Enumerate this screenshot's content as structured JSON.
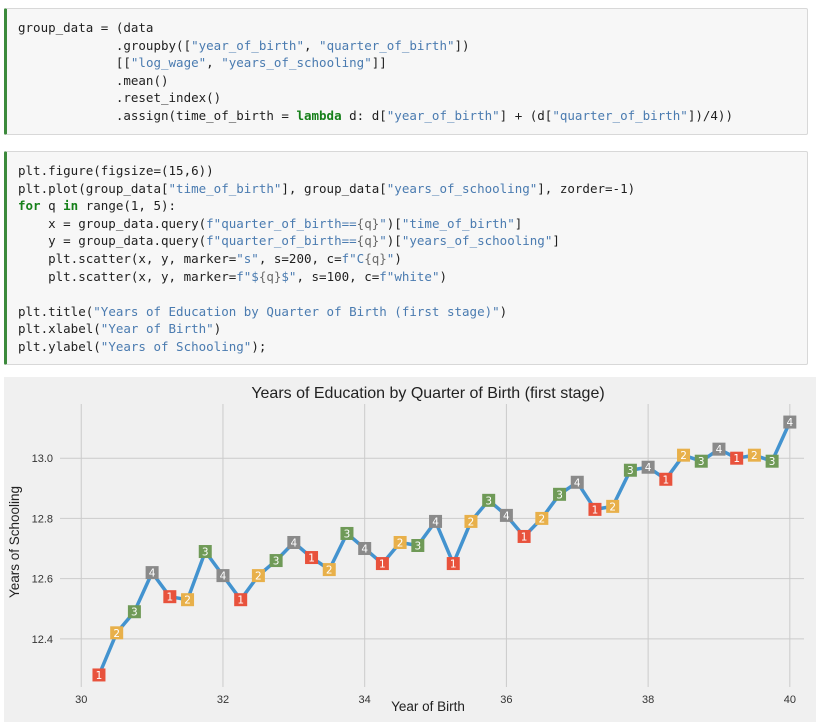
{
  "cells": [
    {
      "lines": [
        [
          [
            "t",
            "group_data = (data"
          ]
        ],
        [
          [
            "t",
            "             .groupby(["
          ],
          [
            "s",
            "\"year_of_birth\""
          ],
          [
            "t",
            ", "
          ],
          [
            "s",
            "\"quarter_of_birth\""
          ],
          [
            "t",
            "])"
          ]
        ],
        [
          [
            "t",
            "             [["
          ],
          [
            "s",
            "\"log_wage\""
          ],
          [
            "t",
            ", "
          ],
          [
            "s",
            "\"years_of_schooling\""
          ],
          [
            "t",
            "]]"
          ]
        ],
        [
          [
            "t",
            "             .mean()"
          ]
        ],
        [
          [
            "t",
            "             .reset_index()"
          ]
        ],
        [
          [
            "t",
            "             .assign(time_of_birth = "
          ],
          [
            "k",
            "lambda"
          ],
          [
            "t",
            " d: d["
          ],
          [
            "s",
            "\"year_of_birth\""
          ],
          [
            "t",
            "] + (d["
          ],
          [
            "s",
            "\"quarter_of_birth\""
          ],
          [
            "t",
            "])/4))"
          ]
        ]
      ]
    },
    {
      "lines": [
        [
          [
            "t",
            "plt.figure(figsize=(15,6))"
          ]
        ],
        [
          [
            "t",
            "plt.plot(group_data["
          ],
          [
            "s",
            "\"time_of_birth\""
          ],
          [
            "t",
            "], group_data["
          ],
          [
            "s",
            "\"years_of_schooling\""
          ],
          [
            "t",
            "], zorder=-1)"
          ]
        ],
        [
          [
            "k",
            "for"
          ],
          [
            "t",
            " q "
          ],
          [
            "k",
            "in"
          ],
          [
            "t",
            " range(1, 5):"
          ]
        ],
        [
          [
            "t",
            "    x = group_data.query("
          ],
          [
            "s",
            "f\"quarter_of_birth=="
          ],
          [
            "fi",
            "{q}"
          ],
          [
            "s",
            "\""
          ],
          [
            "t",
            ")["
          ],
          [
            "s",
            "\"time_of_birth\""
          ],
          [
            "t",
            "]"
          ]
        ],
        [
          [
            "t",
            "    y = group_data.query("
          ],
          [
            "s",
            "f\"quarter_of_birth=="
          ],
          [
            "fi",
            "{q}"
          ],
          [
            "s",
            "\""
          ],
          [
            "t",
            ")["
          ],
          [
            "s",
            "\"years_of_schooling\""
          ],
          [
            "t",
            "]"
          ]
        ],
        [
          [
            "t",
            "    plt.scatter(x, y, marker="
          ],
          [
            "s",
            "\"s\""
          ],
          [
            "t",
            ", s=200, c="
          ],
          [
            "s",
            "f\"C"
          ],
          [
            "fi",
            "{q}"
          ],
          [
            "s",
            "\""
          ],
          [
            "t",
            ")"
          ]
        ],
        [
          [
            "t",
            "    plt.scatter(x, y, marker="
          ],
          [
            "s",
            "f\"$"
          ],
          [
            "fi",
            "{q}"
          ],
          [
            "s",
            "$\""
          ],
          [
            "t",
            ", s=100, c="
          ],
          [
            "s",
            "f\"white\""
          ],
          [
            "t",
            ")"
          ]
        ],
        [
          [
            "t",
            ""
          ]
        ],
        [
          [
            "t",
            "plt.title("
          ],
          [
            "s",
            "\"Years of Education by Quarter of Birth (first stage)\""
          ],
          [
            "t",
            ")"
          ]
        ],
        [
          [
            "t",
            "plt.xlabel("
          ],
          [
            "s",
            "\"Year of Birth\""
          ],
          [
            "t",
            ")"
          ]
        ],
        [
          [
            "t",
            "plt.ylabel("
          ],
          [
            "s",
            "\"Years of Schooling\""
          ],
          [
            "t",
            ");"
          ]
        ]
      ]
    }
  ],
  "colors": {
    "line": "#4393cf",
    "q1": "#e8523c",
    "q2": "#e8b04a",
    "q3": "#6f9a57",
    "q4": "#8a8a8a",
    "plot_bg": "#f0f0f0",
    "grid": "#cbcbcb"
  },
  "chart_data": {
    "type": "line",
    "title": "Years of Education by Quarter of Birth (first stage)",
    "xlabel": "Year of Birth",
    "ylabel": "Years of Schooling",
    "xlim": [
      29.7,
      40.2
    ],
    "ylim": [
      12.24,
      13.18
    ],
    "xticks": [
      30,
      32,
      34,
      36,
      38,
      40
    ],
    "xtick_labels": [
      "30",
      "32",
      "34",
      "36",
      "38",
      "40"
    ],
    "yticks": [
      12.4,
      12.6,
      12.8,
      13.0
    ],
    "ytick_labels": [
      "12.4",
      "12.6",
      "12.8",
      "13.0"
    ],
    "grid": true,
    "points": [
      {
        "x": 30.25,
        "y": 12.28,
        "q": 1
      },
      {
        "x": 30.5,
        "y": 12.42,
        "q": 2
      },
      {
        "x": 30.75,
        "y": 12.49,
        "q": 3
      },
      {
        "x": 31.0,
        "y": 12.62,
        "q": 4
      },
      {
        "x": 31.25,
        "y": 12.54,
        "q": 1
      },
      {
        "x": 31.5,
        "y": 12.53,
        "q": 2
      },
      {
        "x": 31.75,
        "y": 12.69,
        "q": 3
      },
      {
        "x": 32.0,
        "y": 12.61,
        "q": 4
      },
      {
        "x": 32.25,
        "y": 12.53,
        "q": 1
      },
      {
        "x": 32.5,
        "y": 12.61,
        "q": 2
      },
      {
        "x": 32.75,
        "y": 12.66,
        "q": 3
      },
      {
        "x": 33.0,
        "y": 12.72,
        "q": 4
      },
      {
        "x": 33.25,
        "y": 12.67,
        "q": 1
      },
      {
        "x": 33.5,
        "y": 12.63,
        "q": 2
      },
      {
        "x": 33.75,
        "y": 12.75,
        "q": 3
      },
      {
        "x": 34.0,
        "y": 12.7,
        "q": 4
      },
      {
        "x": 34.25,
        "y": 12.65,
        "q": 1
      },
      {
        "x": 34.5,
        "y": 12.72,
        "q": 2
      },
      {
        "x": 34.75,
        "y": 12.71,
        "q": 3
      },
      {
        "x": 35.0,
        "y": 12.79,
        "q": 4
      },
      {
        "x": 35.25,
        "y": 12.65,
        "q": 1
      },
      {
        "x": 35.5,
        "y": 12.79,
        "q": 2
      },
      {
        "x": 35.75,
        "y": 12.86,
        "q": 3
      },
      {
        "x": 36.0,
        "y": 12.81,
        "q": 4
      },
      {
        "x": 36.25,
        "y": 12.74,
        "q": 1
      },
      {
        "x": 36.5,
        "y": 12.8,
        "q": 2
      },
      {
        "x": 36.75,
        "y": 12.88,
        "q": 3
      },
      {
        "x": 37.0,
        "y": 12.92,
        "q": 4
      },
      {
        "x": 37.25,
        "y": 12.83,
        "q": 1
      },
      {
        "x": 37.5,
        "y": 12.84,
        "q": 2
      },
      {
        "x": 37.75,
        "y": 12.96,
        "q": 3
      },
      {
        "x": 38.0,
        "y": 12.97,
        "q": 4
      },
      {
        "x": 38.25,
        "y": 12.93,
        "q": 1
      },
      {
        "x": 38.5,
        "y": 13.01,
        "q": 2
      },
      {
        "x": 38.75,
        "y": 12.99,
        "q": 3
      },
      {
        "x": 39.0,
        "y": 13.03,
        "q": 4
      },
      {
        "x": 39.25,
        "y": 13.0,
        "q": 1
      },
      {
        "x": 39.5,
        "y": 13.01,
        "q": 2
      },
      {
        "x": 39.75,
        "y": 12.99,
        "q": 3
      },
      {
        "x": 40.0,
        "y": 13.12,
        "q": 4
      }
    ]
  }
}
